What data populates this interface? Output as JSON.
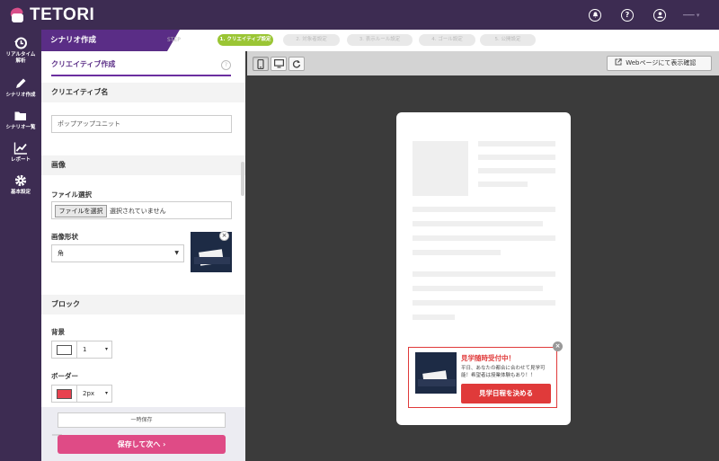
{
  "app": {
    "logo_text": "TETORI"
  },
  "topbar": {
    "icons": [
      "bell-icon",
      "help-icon",
      "user-icon"
    ],
    "user_name": "━━━ ▾"
  },
  "sidebar": {
    "items": [
      {
        "label_line1": "リアルタイム",
        "label_line2": "解析",
        "icon": "history-icon"
      },
      {
        "label_line1": "シナリオ作成",
        "label_line2": "",
        "icon": "pencil-icon"
      },
      {
        "label_line1": "シナリオ一覧",
        "label_line2": "",
        "icon": "folder-icon"
      },
      {
        "label_line1": "レポート",
        "label_line2": "",
        "icon": "chart-icon"
      },
      {
        "label_line1": "基本設定",
        "label_line2": "",
        "icon": "gear-icon"
      }
    ]
  },
  "stepbar": {
    "title": "シナリオ作成",
    "step_label": "STEP",
    "steps": [
      {
        "label": "1. クリエイティブ設定",
        "active": true
      },
      {
        "label": "2. 対象者設定",
        "active": false
      },
      {
        "label": "3. 表示ルール設定",
        "active": false
      },
      {
        "label": "4. ゴール設定",
        "active": false
      },
      {
        "label": "5. 公開設定",
        "active": false
      }
    ]
  },
  "panel": {
    "tab": "クリエイティブ作成",
    "help": "?",
    "creative_name_heading": "クリエイティブ名",
    "creative_name_value": "ポップアップユニット",
    "image_heading": "画像",
    "file_label": "ファイル選択",
    "file_button": "ファイルを選択",
    "file_status": "選択されていません",
    "shape_label": "画像形状",
    "shape_value": "角",
    "block_heading": "ブロック",
    "bg_label": "背景",
    "bg_color": "#ffffff",
    "bg_value": "1",
    "border_label": "ボーダー",
    "border_color": "#e8424f",
    "border_value": "2px",
    "save_temp": "一時保存",
    "ghost_label": "━━━",
    "save_next": "保存して次へ ›"
  },
  "preview": {
    "web_button": "Webページにて表示確認",
    "devices": [
      "smartphone-icon",
      "desktop-icon",
      "refresh-icon"
    ],
    "popup": {
      "title": "見学随時受付中！",
      "body": "平日、あなたの都合に合わせて見学可能！希望者は授業体験もあり！！",
      "cta": "見学日程を決める",
      "close": "×",
      "border_color": "#e03a3a"
    }
  }
}
